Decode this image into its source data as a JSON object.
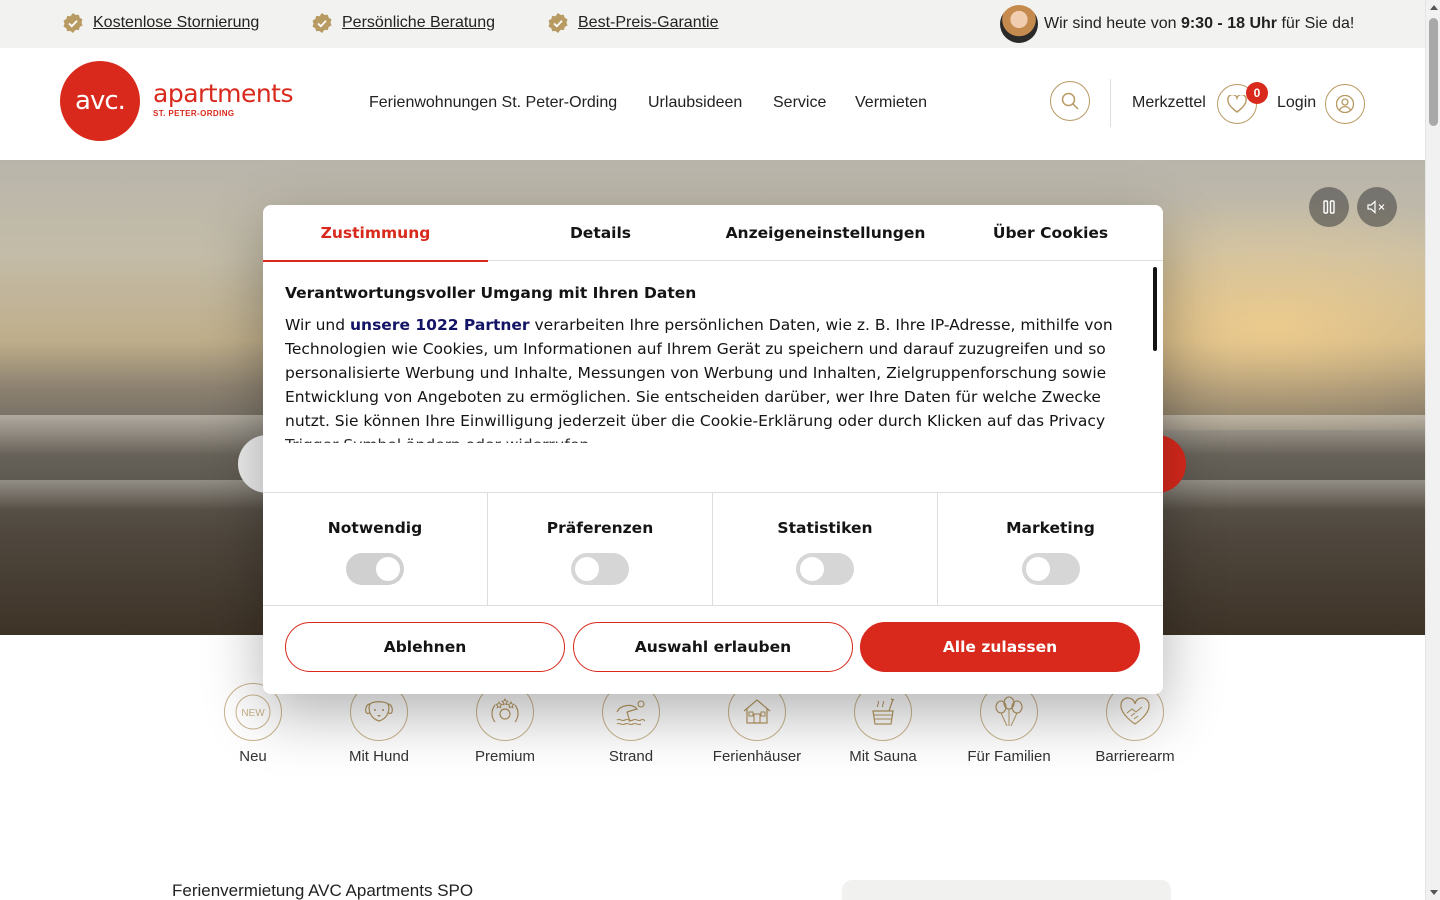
{
  "topbar": {
    "usps": [
      "Kostenlose Stornierung",
      "Persönliche Beratung",
      "Best-Preis-Garantie"
    ],
    "hours_prefix": "Wir sind heute von ",
    "hours_time": "9:30 - 18 Uhr",
    "hours_suffix": " für Sie da!"
  },
  "header": {
    "logo_mark": "avc.",
    "logo_word": "apartments",
    "logo_sub": "ST. PETER-ORDING",
    "nav": [
      "Ferienwohnungen St. Peter-Ording",
      "Urlaubsideen",
      "Service",
      "Vermieten"
    ],
    "wishlist_label": "Merkzettel",
    "wishlist_count": "0",
    "login_label": "Login"
  },
  "categories": [
    {
      "label": "Neu",
      "icon": "new-icon"
    },
    {
      "label": "Mit Hund",
      "icon": "dog-icon"
    },
    {
      "label": "Premium",
      "icon": "premium-icon"
    },
    {
      "label": "Strand",
      "icon": "beach-icon"
    },
    {
      "label": "Ferienhäuser",
      "icon": "house-icon"
    },
    {
      "label": "Mit Sauna",
      "icon": "sauna-icon"
    },
    {
      "label": "Für Familien",
      "icon": "family-icon"
    },
    {
      "label": "Barrierearm",
      "icon": "accessible-icon"
    }
  ],
  "section_title": "Ferienvermietung AVC Apartments SPO",
  "cookie": {
    "tabs": [
      "Zustimmung",
      "Details",
      "Anzeigeneinstellungen",
      "Über Cookies"
    ],
    "heading": "Verantwortungsvoller Umgang mit Ihren Daten",
    "text_before": "Wir und ",
    "partners_link": "unsere 1022 Partner",
    "text_after": " verarbeiten Ihre persönlichen Daten, wie z. B. Ihre IP-Adresse, mithilfe von Technologien wie Cookies, um Informationen auf Ihrem Gerät zu speichern und darauf zuzugreifen und so personalisierte Werbung und Inhalte, Messungen von Werbung und Inhalten, Zielgruppenforschung sowie Entwicklung von Angeboten zu ermöglichen. Sie entscheiden darüber, wer Ihre Daten für welche Zwecke nutzt. Sie können Ihre Einwilligung jederzeit über die Cookie-Erklärung oder durch Klicken auf das Privacy Trigger Symbol ändern oder widerrufen",
    "toggles": [
      {
        "label": "Notwendig",
        "on": true
      },
      {
        "label": "Präferenzen",
        "on": false
      },
      {
        "label": "Statistiken",
        "on": false
      },
      {
        "label": "Marketing",
        "on": false
      }
    ],
    "buttons": {
      "deny": "Ablehnen",
      "allow_selection": "Auswahl erlauben",
      "allow_all": "Alle zulassen"
    }
  },
  "colors": {
    "brand_red": "#d9291c",
    "gold": "#b89a63"
  }
}
